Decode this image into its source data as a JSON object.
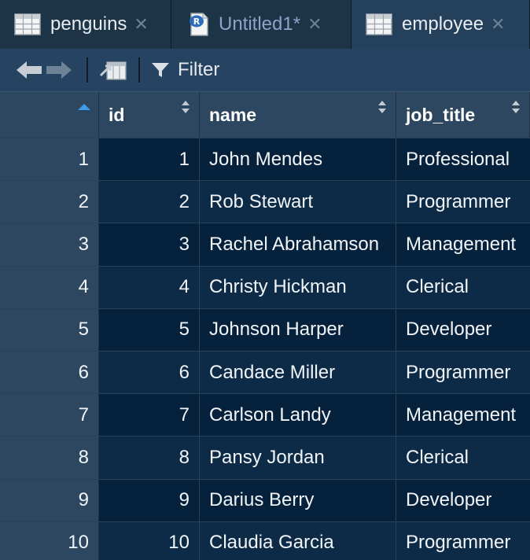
{
  "tabs": [
    {
      "label": "penguins",
      "icon": "table-icon",
      "active": false,
      "modified": false
    },
    {
      "label": "Untitled1*",
      "icon": "r-script-icon",
      "active": false,
      "modified": true
    },
    {
      "label": "employee",
      "icon": "table-icon",
      "active": true,
      "modified": false
    }
  ],
  "toolbar": {
    "filter_label": "Filter"
  },
  "table": {
    "columns": [
      "id",
      "name",
      "job_title"
    ],
    "rows": [
      {
        "row_num": "1",
        "id": "1",
        "name": "John Mendes",
        "job_title": "Professional"
      },
      {
        "row_num": "2",
        "id": "2",
        "name": "Rob Stewart",
        "job_title": "Programmer"
      },
      {
        "row_num": "3",
        "id": "3",
        "name": "Rachel Abrahamson",
        "job_title": "Management"
      },
      {
        "row_num": "4",
        "id": "4",
        "name": "Christy Hickman",
        "job_title": "Clerical"
      },
      {
        "row_num": "5",
        "id": "5",
        "name": "Johnson Harper",
        "job_title": "Developer"
      },
      {
        "row_num": "6",
        "id": "6",
        "name": "Candace Miller",
        "job_title": "Programmer"
      },
      {
        "row_num": "7",
        "id": "7",
        "name": "Carlson Landy",
        "job_title": "Management"
      },
      {
        "row_num": "8",
        "id": "8",
        "name": "Pansy Jordan",
        "job_title": "Clerical"
      },
      {
        "row_num": "9",
        "id": "9",
        "name": "Darius Berry",
        "job_title": "Developer"
      },
      {
        "row_num": "10",
        "id": "10",
        "name": "Claudia Garcia",
        "job_title": "Programmer"
      }
    ]
  },
  "colors": {
    "background": "#0f2a40",
    "header": "#2c475f",
    "row_odd": "#06213b",
    "row_even": "#0d2b47",
    "sort_active": "#3f9be6"
  }
}
